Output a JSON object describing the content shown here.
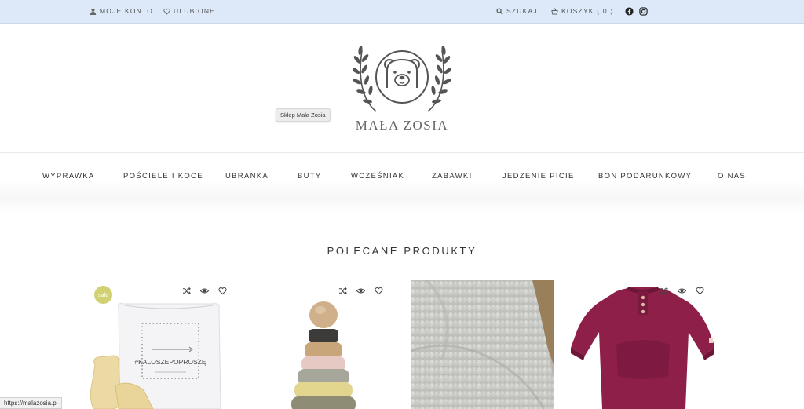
{
  "topbar": {
    "account_label": "MOJE KONTO",
    "wishlist_label": "ULUBIONE",
    "search_label": "SZUKAJ",
    "cart_label": "KOSZYK ( 0 )"
  },
  "header": {
    "brand_name": "MAŁA ZOSIA",
    "logo_tooltip": "Sklep Mała Zosia"
  },
  "nav": {
    "items": [
      "WYPRAWKA",
      "POŚCIELE I KOCE",
      "UBRANKA",
      "BUTY",
      "WCZEŚNIAK",
      "ZABAWKI",
      "JEDZENIE PICIE",
      "BON PODARUNKOWY",
      "O NAS"
    ]
  },
  "featured": {
    "title": "POLECANE PRODUKTY",
    "products": [
      {
        "image": "drawstring-bag-and-rain-boots",
        "badge": "sale",
        "bag_text": "#KALOSZEPOPROSZĘ"
      },
      {
        "image": "wooden-stacking-rings"
      },
      {
        "image": "grey-knitted-blanket"
      },
      {
        "image": "burgundy-romper"
      }
    ]
  },
  "status_bar": {
    "url": "https://malazosia.pl"
  },
  "colors": {
    "topbar_bg": "#dde9f8",
    "sale_badge": "#d1d173",
    "romper": "#8e1f49"
  }
}
